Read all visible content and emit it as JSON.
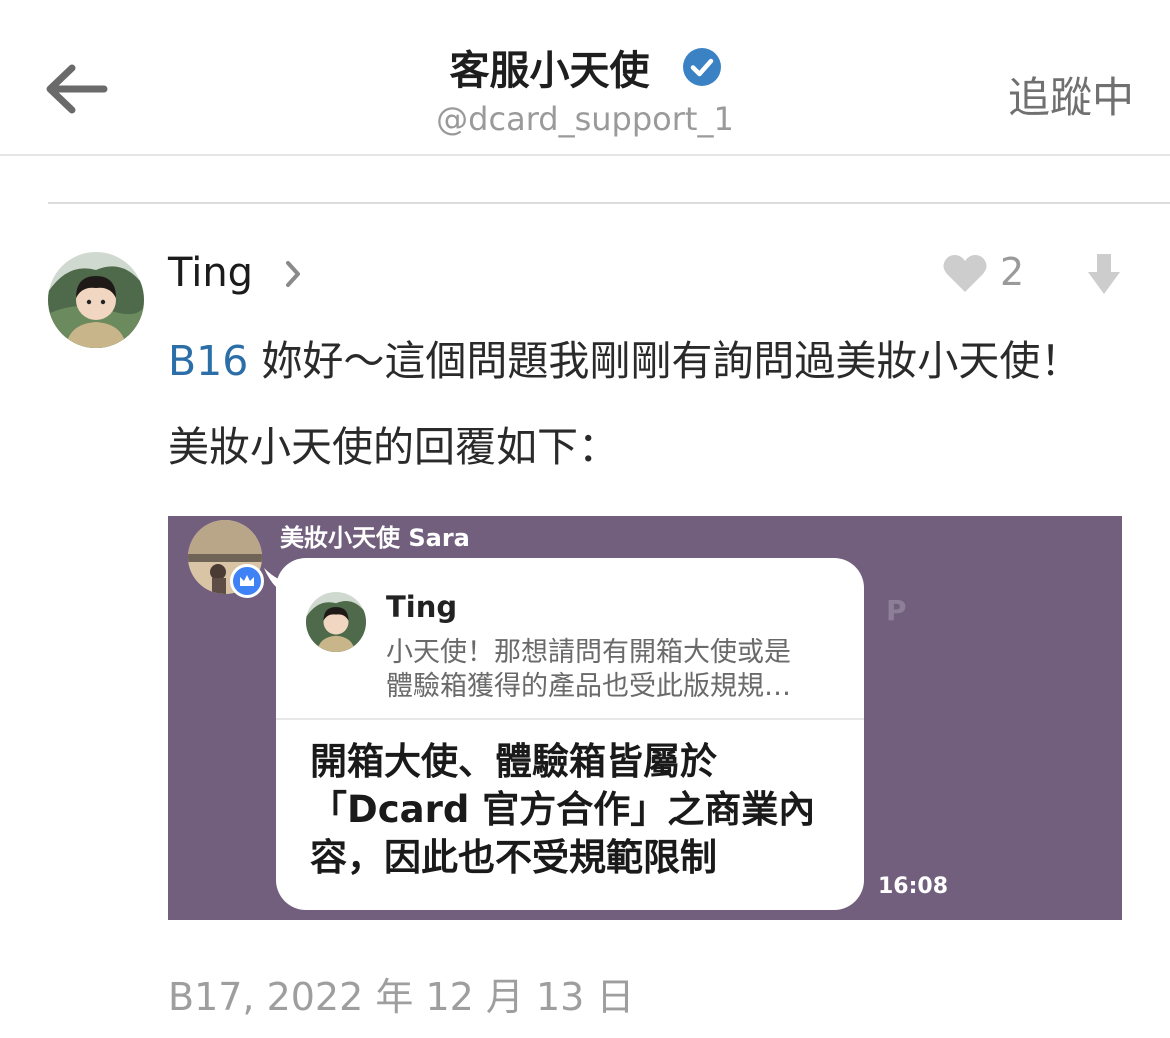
{
  "header": {
    "title": "客服小天使",
    "handle": "@dcard_support_1",
    "follow_label": "追蹤中"
  },
  "post": {
    "author": "Ting",
    "like_count": "2",
    "floor_ref": "B16",
    "body": " 妳好～這個問題我剛剛有詢問過美妝小天使！美妝小天使的回覆如下：",
    "meta": "B17, 2022 年 12 月 13 日"
  },
  "embedded_screenshot": {
    "sender": "美妝小天使 Sara",
    "quoted_author": "Ting",
    "quoted_line1": "小天使！那想請問有開箱大使或是",
    "quoted_line2": "體驗箱獲得的產品也受此版規規…",
    "reply_lines": [
      "開箱大使、體驗箱皆屬於",
      "「Dcard 官方合作」之商業內",
      "容，因此也不受規範限制"
    ],
    "time": "16:08",
    "background_text": "P"
  },
  "colors": {
    "verified": "#3b82c4",
    "floor_link": "#2c6fa8",
    "embed_bg": "#725f7d"
  }
}
